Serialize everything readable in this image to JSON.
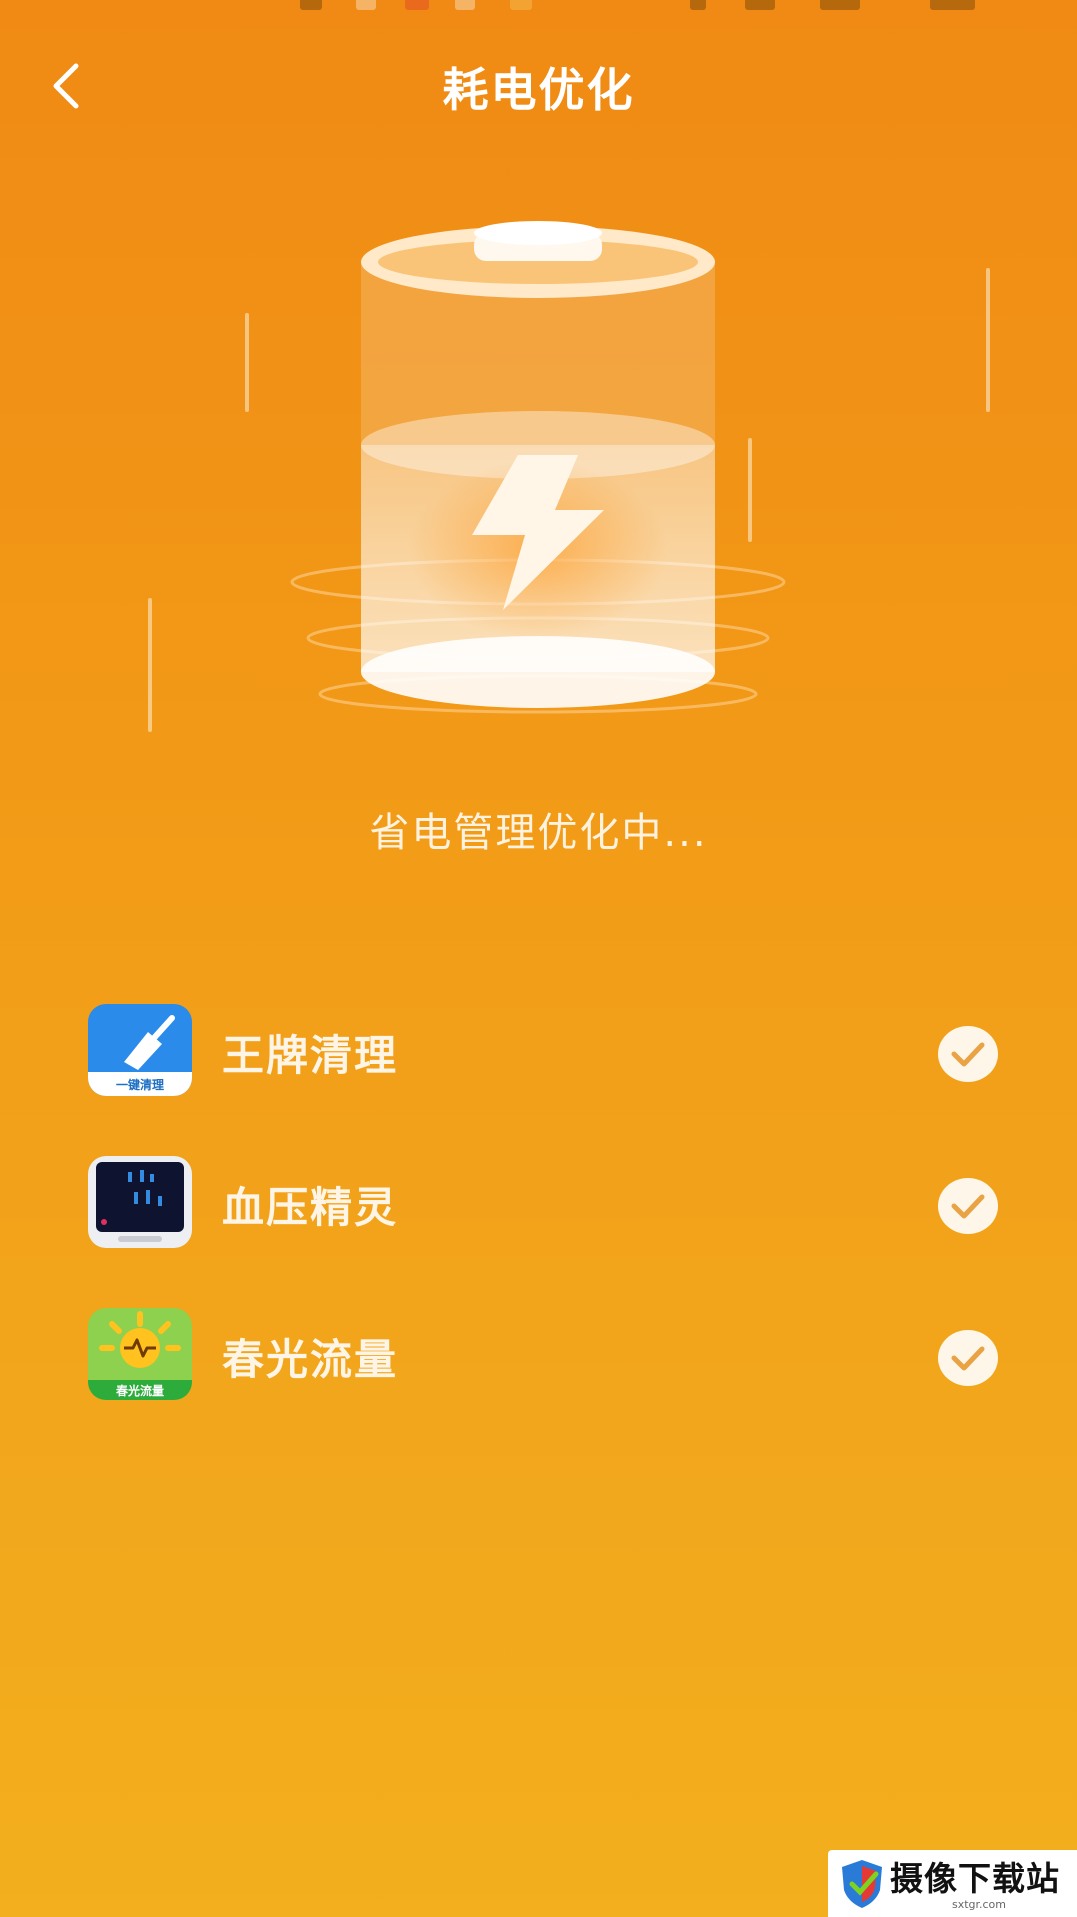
{
  "header": {
    "title": "耗电优化"
  },
  "hero": {
    "status_text": "省电管理优化中..."
  },
  "apps": [
    {
      "name": "王牌清理",
      "icon": "broom-cleaner-icon",
      "icon_caption": "一键清理",
      "checked": true
    },
    {
      "name": "血压精灵",
      "icon": "blood-pressure-monitor-icon",
      "checked": true
    },
    {
      "name": "春光流量",
      "icon": "sun-traffic-icon",
      "icon_caption": "春光流量",
      "checked": true
    }
  ],
  "watermark": {
    "text": "摄像下载站",
    "url": "sxtgr.com"
  },
  "colors": {
    "background_top": "#F08A14",
    "background_bottom": "#F3AF1D",
    "foreground": "#FFFFFF"
  }
}
